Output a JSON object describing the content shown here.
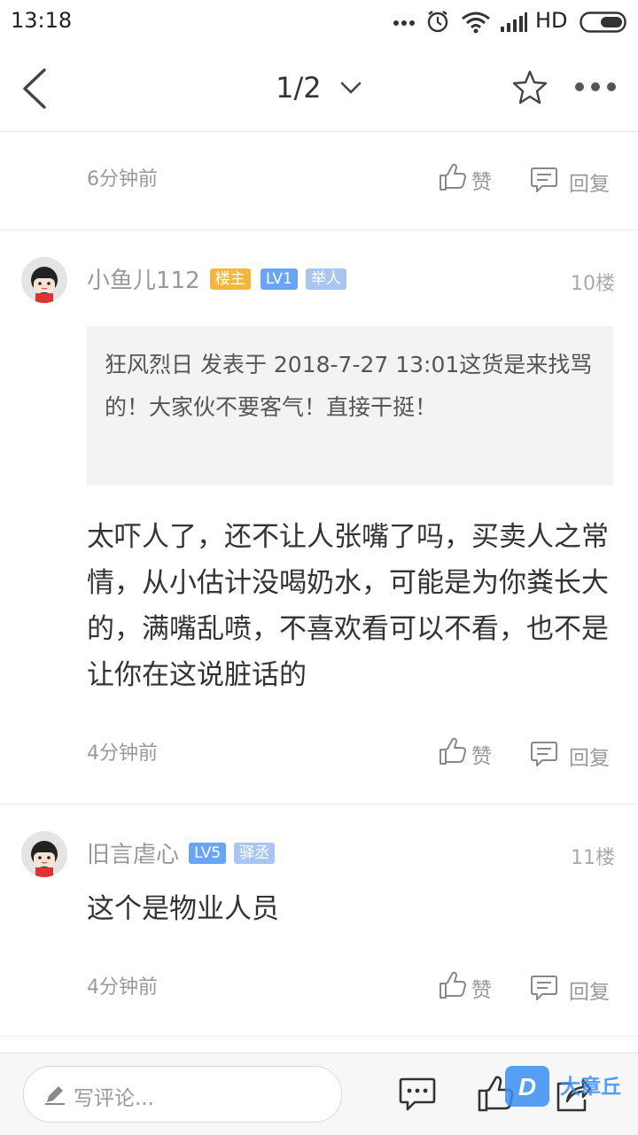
{
  "status_bar": {
    "time": "13:18",
    "network": "HD"
  },
  "header": {
    "page_indicator": "1/2"
  },
  "first_partial": {
    "time": "6分钟前",
    "like_label": "赞",
    "reply_label": "回复"
  },
  "comments": [
    {
      "username": "小鱼儿112",
      "badges": [
        {
          "text": "楼主",
          "color": "#f6b63e"
        },
        {
          "text": "LV1",
          "color": "#6aa5f5"
        },
        {
          "text": "举人",
          "color": "#a9c6f0"
        }
      ],
      "floor": "10楼",
      "quote": "狂风烈日 发表于 2018-7-27 13:01这货是来找骂的！大家伙不要客气！直接干挺！",
      "text": "太吓人了，还不让人张嘴了吗，买卖人之常情，从小估计没喝奶水，可能是为你粪长大的，满嘴乱喷，不喜欢看可以不看，也不是让你在这说脏话的",
      "time": "4分钟前",
      "like_label": "赞",
      "reply_label": "回复"
    },
    {
      "username": "旧言虐心",
      "badges": [
        {
          "text": "LV5",
          "color": "#6aa5f5"
        },
        {
          "text": "驿丞",
          "color": "#a9c6f0"
        }
      ],
      "floor": "11楼",
      "text": "这个是物业人员",
      "time": "4分钟前",
      "like_label": "赞",
      "reply_label": "回复"
    }
  ],
  "bottom_bar": {
    "placeholder": "写评论...",
    "watermark": "大章丘"
  },
  "colors": {
    "background": "#ffffff",
    "divider": "#ebebeb",
    "watermark_blue": "#3b8ff3"
  }
}
